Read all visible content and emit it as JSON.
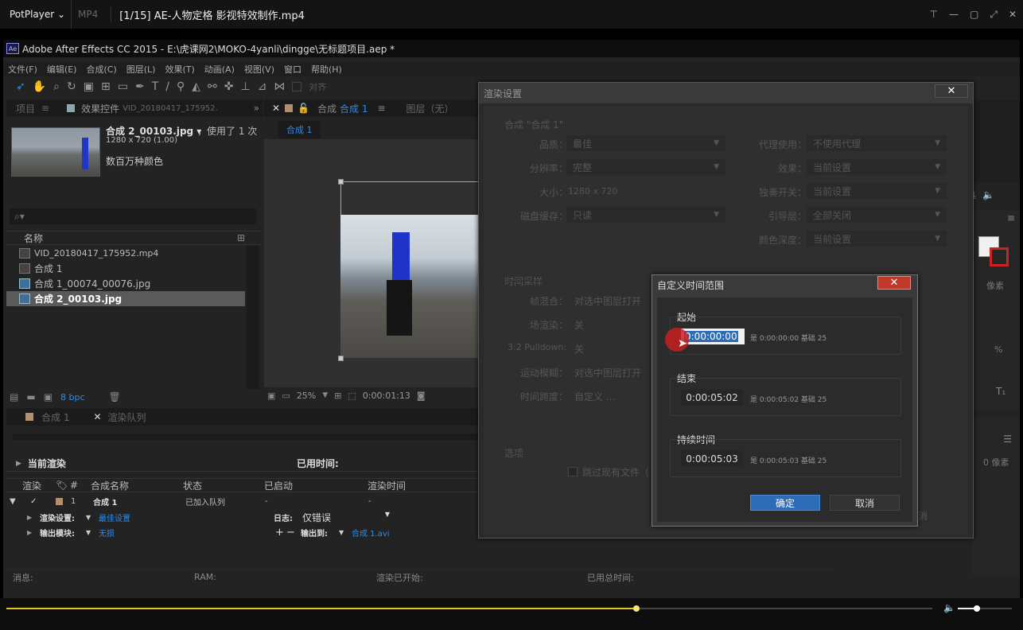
{
  "player": {
    "brand": "PotPlayer ⌄",
    "format": "MP4",
    "file": "[1/15] AE-人物定格 影视特效制作.mp4",
    "win_buttons": [
      "⊤",
      "—",
      "▢",
      "⤢",
      "✕"
    ]
  },
  "ae": {
    "title": "Adobe After Effects CC 2015 - E:\\虎课网2\\MOKO-4yanli\\dingge\\无标题项目.aep *",
    "logo": "Ae",
    "menu": [
      "文件(F)",
      "编辑(E)",
      "合成(C)",
      "图层(L)",
      "效果(T)",
      "动画(A)",
      "视图(V)",
      "窗口",
      "帮助(H)"
    ],
    "toolbar_snap": "对齐"
  },
  "project": {
    "tab1": "项目",
    "tab2": "效果控件",
    "tab2_file": "VID_20180417_175952.",
    "thumb_name": "合成 2_00103.jpg ▾",
    "thumb_used": "，使用了 1 次",
    "thumb_size": "1280 x 720 (1.00)",
    "thumb_color": "数百万种颜色",
    "search_icon": "⌕▾",
    "col_name": "名称",
    "items": [
      "VID_20180417_175952.mp4",
      "合成 1",
      "合成 1_00074_00076.jpg",
      "合成 2_00103.jpg"
    ],
    "bpc": "8 bpc"
  },
  "comp": {
    "tab": "合成",
    "tab_name": "合成 1",
    "layer_tab": "图层（无）",
    "crumb": "合成 1",
    "zoom": "25%",
    "timecode": "0:00:01:13"
  },
  "queue": {
    "tab1": "合成 1",
    "tab2": "渲染队列",
    "current_render": "当前渲染",
    "elapsed": "已用时间:",
    "cols": [
      "渲染",
      "#",
      "合成名称",
      "状态",
      "已启动",
      "渲染时间"
    ],
    "item_num": "1",
    "item_name": "合成 1",
    "item_status": "已加入队列",
    "item_started": "-",
    "item_time": "-",
    "render_settings_label": "渲染设置:",
    "render_settings_value": "最佳设置",
    "log_label": "日志:",
    "log_value": "仅错误",
    "output_module_label": "输出模块:",
    "output_module_value": "无损",
    "output_to_label": "输出到:",
    "output_to_value": "合成 1.avi",
    "status_msg": "消息:",
    "status_ram": "RAM:",
    "status_started": "渲染已开始:",
    "status_total": "已用总时间:"
  },
  "render_dialog": {
    "title": "渲染设置",
    "close": "✕",
    "comp_group": "合成 \"合成 1\"",
    "quality_label": "品质：",
    "quality_value": "最佳",
    "resolution_label": "分辨率：",
    "resolution_value": "完整",
    "size_label": "大小：",
    "size_value": "1280 x 720",
    "disk_cache_label": "磁盘缓存：",
    "disk_cache_value": "只读",
    "proxy_label": "代理使用：",
    "proxy_value": "不使用代理",
    "effects_label": "效果：",
    "effects_value": "当前设置",
    "solo_label": "独奏开关：",
    "solo_value": "当前设置",
    "guide_label": "引导层：",
    "guide_value": "全部关闭",
    "depth_label": "颜色深度：",
    "depth_value": "当前设置",
    "time_group": "时间采样",
    "frame_blend_label": "帧混合：",
    "frame_blend_value": "对选中图层打开",
    "field_label": "场渲染：",
    "field_value": "关",
    "pulldown_label": "3:2 Pulldown:",
    "pulldown_value": "关",
    "motion_blur_label": "运动模糊：",
    "motion_blur_value": "对选中图层打开",
    "time_span_label": "时间跨度：",
    "time_span_value": "自定义 ...",
    "options_group": "选项",
    "skip_existing": "跳过现有文件（",
    "cancel_partial": "消"
  },
  "time_dialog": {
    "title": "自定义时间范围",
    "close": "✕",
    "start_label": "起始",
    "start_value": "0:00:00:00",
    "start_note": "是 0:00:00:00  基础 25",
    "end_label": "结束",
    "end_value": "0:00:05:02",
    "end_note": "是 0:00:05:02  基础 25",
    "duration_label": "持续时间",
    "duration_value": "0:00:05:03",
    "duration_note": "是 0:00:05:03  基础 25",
    "ok": "确定",
    "cancel": "取消"
  },
  "right_panel": {
    "pixels1": "像素",
    "pixels2": "0 像素",
    "percent": "%",
    "text_icon": "T₁"
  },
  "seek": {
    "progress": 0.68,
    "volume": 0.35
  },
  "colors": {
    "accent_blue": "#2d8ceb",
    "seek_yellow": "#e6c619",
    "ok_button": "#2d6db8",
    "close_red": "#c0392b"
  }
}
